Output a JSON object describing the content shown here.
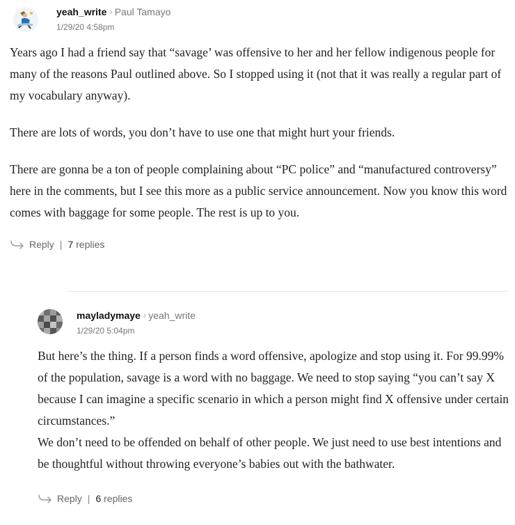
{
  "comments": [
    {
      "author": "yeah_write",
      "reply_to": "Paul Tamayo",
      "timestamp": "1/29/20 4:58pm",
      "paragraphs": [
        "Years ago I had a friend say that “savage’ was offensive to her and her fellow indigenous people for many of the reasons Paul outlined above. So I stopped using it (not that it was really a regular part of my vocabulary anyway).",
        "There are lots of words, you don’t have to use one that might hurt your friends.",
        "There are gonna be a ton of people complaining about “PC police” and “manufactured controversy” here in the comments, but I see this more as a public service announcement. Now you know this word comes with baggage for some people. The rest is up to you."
      ],
      "reply_label": "Reply",
      "replies_count": "7",
      "replies_label": "replies"
    },
    {
      "author": "mayladymaye",
      "reply_to": "yeah_write",
      "timestamp": "1/29/20 5:04pm",
      "paragraphs": [
        "But here’s the thing. If a person finds a word offensive, apologize and stop using it. For 99.99% of the population, savage is a word with no baggage. We need to stop saying “you can’t say X because I can imagine a specific scenario in which a person might find X offensive under certain circumstances.”",
        "We don’t need to be offended on behalf of other people. We just need to use best intentions and be thoughtful without throwing everyone’s babies out with the bathwater."
      ],
      "reply_label": "Reply",
      "replies_count": "6",
      "replies_label": "replies"
    }
  ],
  "icons": {
    "reply": "reply-arrow-icon",
    "chevron": "chevron-right-icon"
  },
  "colors": {
    "text": "#222222",
    "meta": "#777777",
    "divider": "#e6e6e6"
  }
}
